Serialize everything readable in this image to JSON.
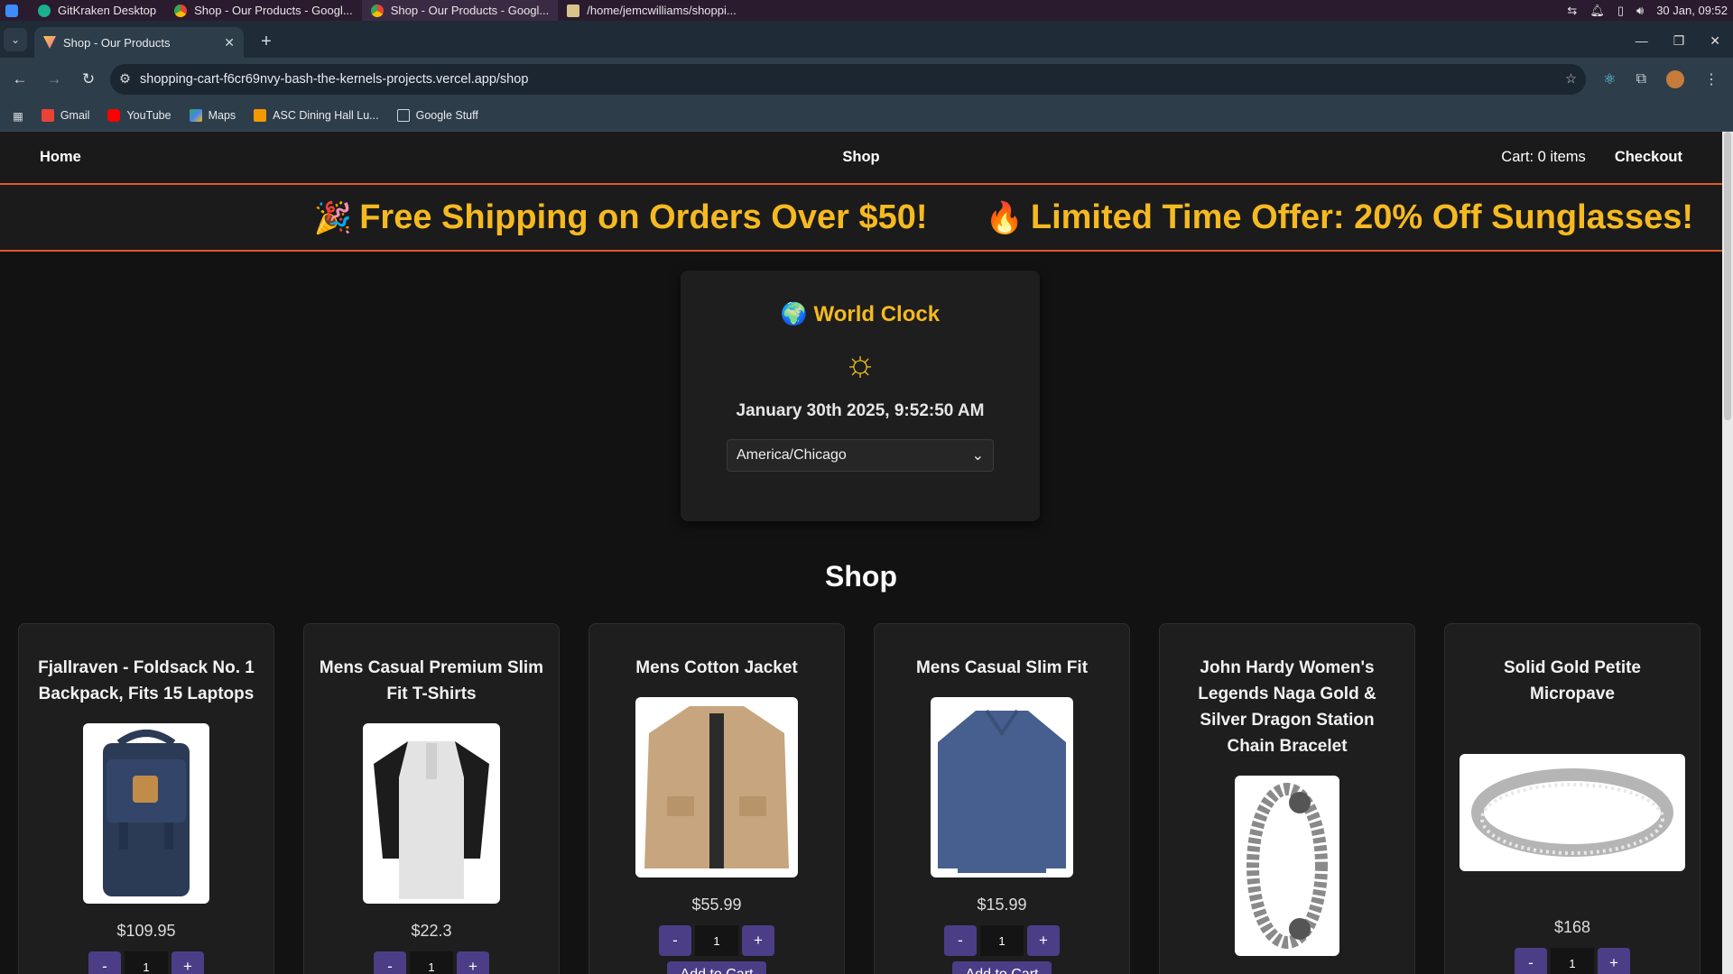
{
  "os_bar": {
    "tasks": [
      {
        "label": "GitKraken Desktop"
      },
      {
        "label": "Shop - Our Products - Googl..."
      },
      {
        "label": "Shop - Our Products - Googl..."
      },
      {
        "label": "/home/jemcwilliams/shoppi..."
      }
    ],
    "datetime": "30 Jan, 09:52"
  },
  "browser": {
    "tab_title": "Shop - Our Products",
    "tab_close": "✕",
    "new_tab": "+",
    "url": "shopping-cart-f6cr69nvy-bash-the-kernels-projects.vercel.app/shop",
    "bookmarks": [
      {
        "label": "Gmail",
        "color": "#ea4335"
      },
      {
        "label": "YouTube",
        "color": "#ff0000"
      },
      {
        "label": "Maps",
        "color": "#34a853"
      },
      {
        "label": "ASC Dining Hall Lu...",
        "color": "#f29900"
      },
      {
        "label": "Google Stuff",
        "color": "#9aa0a6"
      }
    ]
  },
  "site_nav": {
    "home": "Home",
    "shop": "Shop",
    "cart": "Cart: 0 items",
    "checkout": "Checkout"
  },
  "promo": {
    "item1_emoji": "🎉",
    "item1": "Free Shipping on Orders Over $50!",
    "item2_emoji": "🔥",
    "item2": "Limited Time Offer: 20% Off Sunglasses!"
  },
  "clock": {
    "emoji": "🌍",
    "title": "World Clock",
    "sun": "☼",
    "time": "January 30th 2025, 9:52:50 AM",
    "timezone": "America/Chicago"
  },
  "shop": {
    "title": "Shop",
    "products": [
      {
        "name": "Fjallraven - Foldsack No. 1 Backpack, Fits 15 Laptops",
        "price": "$109.95",
        "qty": "1",
        "img": "backpack"
      },
      {
        "name": "Mens Casual Premium Slim Fit T-Shirts",
        "price": "$22.3",
        "qty": "1",
        "img": "tshirt"
      },
      {
        "name": "Mens Cotton Jacket",
        "price": "$55.99",
        "qty": "1",
        "img": "jacket",
        "add": "Add to Cart"
      },
      {
        "name": "Mens Casual Slim Fit",
        "price": "$15.99",
        "qty": "1",
        "img": "longsleeve",
        "add": "Add to Cart"
      },
      {
        "name": "John Hardy Women's Legends Naga Gold & Silver Dragon Station Chain Bracelet",
        "price": "",
        "qty": "",
        "img": "bracelet"
      },
      {
        "name": "Solid Gold Petite Micropave",
        "price": "$168",
        "qty": "1",
        "img": "ring"
      }
    ],
    "minus": "-",
    "plus": "+"
  },
  "colors": {
    "accent_orange": "#e05a2b",
    "promo_gold": "#f5b921",
    "button_purple": "#4b3e86"
  }
}
